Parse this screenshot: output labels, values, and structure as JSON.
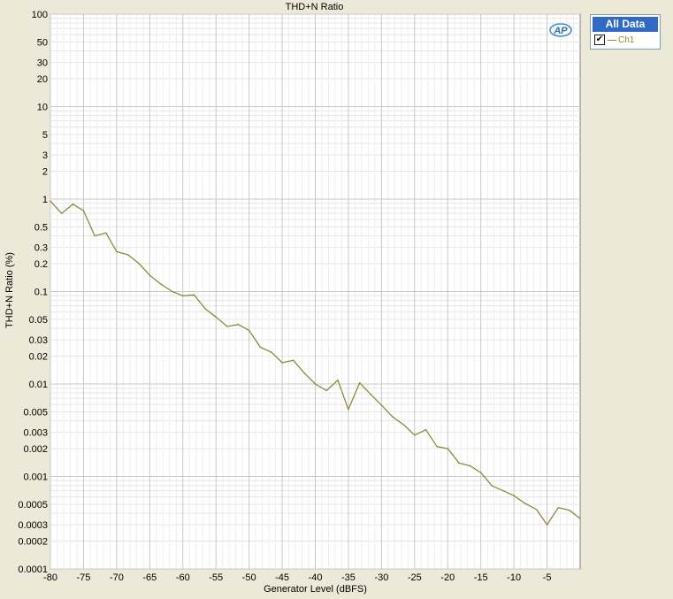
{
  "chart_data": {
    "type": "line",
    "title": "THD+N Ratio",
    "xlabel": "Generator Level (dBFS)",
    "ylabel": "THD+N Ratio (%)",
    "xlim": [
      -80,
      0
    ],
    "ylim": [
      0.0001,
      100
    ],
    "yscale": "log",
    "grid": true,
    "legend_position": "top-right",
    "x_ticks": [
      -80,
      -75,
      -70,
      -65,
      -60,
      -55,
      -50,
      -45,
      -40,
      -35,
      -30,
      -25,
      -20,
      -15,
      -10,
      -5
    ],
    "x_tick_labels": [
      "-80",
      "-75",
      "-70",
      "-65",
      "-60",
      "-55",
      "-50",
      "-45",
      "-40",
      "-35",
      "-30",
      "-25",
      "-20",
      "-15",
      "-10",
      "-5"
    ],
    "y_ticks": [
      100,
      50,
      30,
      20,
      10,
      5,
      3,
      2,
      1,
      0.5,
      0.3,
      0.2,
      0.1,
      0.05,
      0.03,
      0.02,
      0.01,
      0.005,
      0.003,
      0.002,
      0.001,
      0.0005,
      0.0003,
      0.0002,
      0.0001
    ],
    "y_tick_labels": [
      "100",
      "50",
      "30",
      "20",
      "10",
      "5",
      "3",
      "2",
      "1",
      "0.5",
      "0.3",
      "0.2",
      "0.1",
      "0.05",
      "0.03",
      "0.02",
      "0.01",
      "0.005",
      "0.003",
      "0.002",
      "0.001",
      "0.0005",
      "0.0003",
      "0.0002",
      "0.0001"
    ],
    "series": [
      {
        "name": "Ch1",
        "color": "#8b8b3a",
        "x": [
          -80,
          -78.3,
          -76.6,
          -75,
          -73.3,
          -71.6,
          -70,
          -68.3,
          -66.6,
          -65,
          -63.3,
          -61.6,
          -60,
          -58.3,
          -56.6,
          -55,
          -53.3,
          -51.6,
          -50,
          -48.3,
          -46.6,
          -45,
          -43.3,
          -41.6,
          -40,
          -38.3,
          -36.6,
          -35,
          -33.3,
          -31.6,
          -30,
          -28.3,
          -26.6,
          -25,
          -23.3,
          -21.6,
          -20,
          -18.3,
          -16.6,
          -15,
          -13.3,
          -11.6,
          -10,
          -8.3,
          -6.6,
          -5,
          -3.3,
          -1.6,
          0
        ],
        "values": [
          0.95,
          0.7,
          0.88,
          0.75,
          0.4,
          0.43,
          0.27,
          0.25,
          0.2,
          0.15,
          0.12,
          0.1,
          0.09,
          0.092,
          0.065,
          0.053,
          0.042,
          0.044,
          0.038,
          0.025,
          0.022,
          0.017,
          0.018,
          0.013,
          0.01,
          0.0085,
          0.011,
          0.0053,
          0.0103,
          0.0077,
          0.0059,
          0.0044,
          0.0036,
          0.0028,
          0.0032,
          0.0021,
          0.002,
          0.0014,
          0.0013,
          0.0011,
          0.00079,
          0.0007,
          0.00062,
          0.00051,
          0.00044,
          0.0003,
          0.00046,
          0.00043,
          0.00035
        ]
      }
    ]
  },
  "legend": {
    "header": "All Data",
    "items": [
      {
        "label": "Ch1",
        "checked": true,
        "check_glyph": "✔"
      }
    ]
  },
  "logo_text": "AP"
}
